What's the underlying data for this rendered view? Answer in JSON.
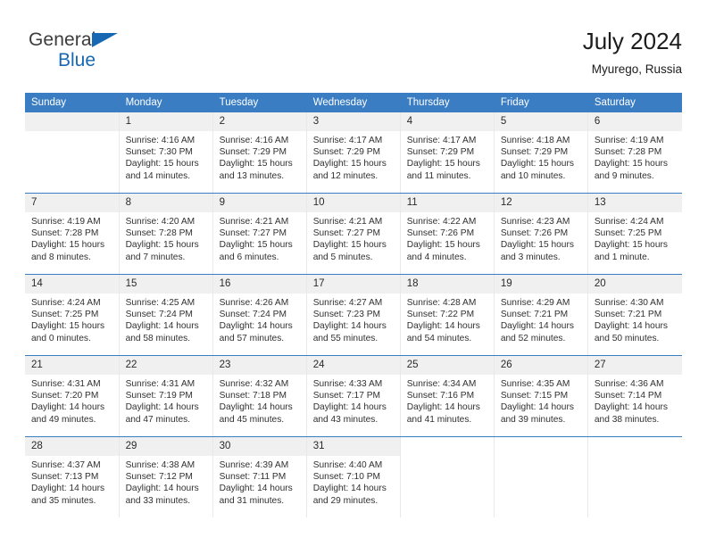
{
  "brand": {
    "name_top": "General",
    "name_bottom": "Blue",
    "triangle_color": "#1668b3"
  },
  "header": {
    "title": "July 2024",
    "subtitle": "Myurego, Russia"
  },
  "theme": {
    "header_blue": "#3a7dc3",
    "daynum_bg": "#f0f0f0",
    "text": "#303030"
  },
  "weekday_headers": [
    "Sunday",
    "Monday",
    "Tuesday",
    "Wednesday",
    "Thursday",
    "Friday",
    "Saturday"
  ],
  "calendar": {
    "weeks": [
      [
        {
          "day": "",
          "blank": true,
          "lines": []
        },
        {
          "day": "1",
          "lines": [
            "Sunrise: 4:16 AM",
            "Sunset: 7:30 PM",
            "Daylight: 15 hours",
            "and 14 minutes."
          ]
        },
        {
          "day": "2",
          "lines": [
            "Sunrise: 4:16 AM",
            "Sunset: 7:29 PM",
            "Daylight: 15 hours",
            "and 13 minutes."
          ]
        },
        {
          "day": "3",
          "lines": [
            "Sunrise: 4:17 AM",
            "Sunset: 7:29 PM",
            "Daylight: 15 hours",
            "and 12 minutes."
          ]
        },
        {
          "day": "4",
          "lines": [
            "Sunrise: 4:17 AM",
            "Sunset: 7:29 PM",
            "Daylight: 15 hours",
            "and 11 minutes."
          ]
        },
        {
          "day": "5",
          "lines": [
            "Sunrise: 4:18 AM",
            "Sunset: 7:29 PM",
            "Daylight: 15 hours",
            "and 10 minutes."
          ]
        },
        {
          "day": "6",
          "lines": [
            "Sunrise: 4:19 AM",
            "Sunset: 7:28 PM",
            "Daylight: 15 hours",
            "and 9 minutes."
          ]
        }
      ],
      [
        {
          "day": "7",
          "lines": [
            "Sunrise: 4:19 AM",
            "Sunset: 7:28 PM",
            "Daylight: 15 hours",
            "and 8 minutes."
          ]
        },
        {
          "day": "8",
          "lines": [
            "Sunrise: 4:20 AM",
            "Sunset: 7:28 PM",
            "Daylight: 15 hours",
            "and 7 minutes."
          ]
        },
        {
          "day": "9",
          "lines": [
            "Sunrise: 4:21 AM",
            "Sunset: 7:27 PM",
            "Daylight: 15 hours",
            "and 6 minutes."
          ]
        },
        {
          "day": "10",
          "lines": [
            "Sunrise: 4:21 AM",
            "Sunset: 7:27 PM",
            "Daylight: 15 hours",
            "and 5 minutes."
          ]
        },
        {
          "day": "11",
          "lines": [
            "Sunrise: 4:22 AM",
            "Sunset: 7:26 PM",
            "Daylight: 15 hours",
            "and 4 minutes."
          ]
        },
        {
          "day": "12",
          "lines": [
            "Sunrise: 4:23 AM",
            "Sunset: 7:26 PM",
            "Daylight: 15 hours",
            "and 3 minutes."
          ]
        },
        {
          "day": "13",
          "lines": [
            "Sunrise: 4:24 AM",
            "Sunset: 7:25 PM",
            "Daylight: 15 hours",
            "and 1 minute."
          ]
        }
      ],
      [
        {
          "day": "14",
          "lines": [
            "Sunrise: 4:24 AM",
            "Sunset: 7:25 PM",
            "Daylight: 15 hours",
            "and 0 minutes."
          ]
        },
        {
          "day": "15",
          "lines": [
            "Sunrise: 4:25 AM",
            "Sunset: 7:24 PM",
            "Daylight: 14 hours",
            "and 58 minutes."
          ]
        },
        {
          "day": "16",
          "lines": [
            "Sunrise: 4:26 AM",
            "Sunset: 7:24 PM",
            "Daylight: 14 hours",
            "and 57 minutes."
          ]
        },
        {
          "day": "17",
          "lines": [
            "Sunrise: 4:27 AM",
            "Sunset: 7:23 PM",
            "Daylight: 14 hours",
            "and 55 minutes."
          ]
        },
        {
          "day": "18",
          "lines": [
            "Sunrise: 4:28 AM",
            "Sunset: 7:22 PM",
            "Daylight: 14 hours",
            "and 54 minutes."
          ]
        },
        {
          "day": "19",
          "lines": [
            "Sunrise: 4:29 AM",
            "Sunset: 7:21 PM",
            "Daylight: 14 hours",
            "and 52 minutes."
          ]
        },
        {
          "day": "20",
          "lines": [
            "Sunrise: 4:30 AM",
            "Sunset: 7:21 PM",
            "Daylight: 14 hours",
            "and 50 minutes."
          ]
        }
      ],
      [
        {
          "day": "21",
          "lines": [
            "Sunrise: 4:31 AM",
            "Sunset: 7:20 PM",
            "Daylight: 14 hours",
            "and 49 minutes."
          ]
        },
        {
          "day": "22",
          "lines": [
            "Sunrise: 4:31 AM",
            "Sunset: 7:19 PM",
            "Daylight: 14 hours",
            "and 47 minutes."
          ]
        },
        {
          "day": "23",
          "lines": [
            "Sunrise: 4:32 AM",
            "Sunset: 7:18 PM",
            "Daylight: 14 hours",
            "and 45 minutes."
          ]
        },
        {
          "day": "24",
          "lines": [
            "Sunrise: 4:33 AM",
            "Sunset: 7:17 PM",
            "Daylight: 14 hours",
            "and 43 minutes."
          ]
        },
        {
          "day": "25",
          "lines": [
            "Sunrise: 4:34 AM",
            "Sunset: 7:16 PM",
            "Daylight: 14 hours",
            "and 41 minutes."
          ]
        },
        {
          "day": "26",
          "lines": [
            "Sunrise: 4:35 AM",
            "Sunset: 7:15 PM",
            "Daylight: 14 hours",
            "and 39 minutes."
          ]
        },
        {
          "day": "27",
          "lines": [
            "Sunrise: 4:36 AM",
            "Sunset: 7:14 PM",
            "Daylight: 14 hours",
            "and 38 minutes."
          ]
        }
      ],
      [
        {
          "day": "28",
          "lines": [
            "Sunrise: 4:37 AM",
            "Sunset: 7:13 PM",
            "Daylight: 14 hours",
            "and 35 minutes."
          ]
        },
        {
          "day": "29",
          "lines": [
            "Sunrise: 4:38 AM",
            "Sunset: 7:12 PM",
            "Daylight: 14 hours",
            "and 33 minutes."
          ]
        },
        {
          "day": "30",
          "lines": [
            "Sunrise: 4:39 AM",
            "Sunset: 7:11 PM",
            "Daylight: 14 hours",
            "and 31 minutes."
          ]
        },
        {
          "day": "31",
          "lines": [
            "Sunrise: 4:40 AM",
            "Sunset: 7:10 PM",
            "Daylight: 14 hours",
            "and 29 minutes."
          ]
        },
        {
          "day": "",
          "empty": true,
          "lines": []
        },
        {
          "day": "",
          "empty": true,
          "lines": []
        },
        {
          "day": "",
          "empty": true,
          "lines": []
        }
      ]
    ]
  }
}
